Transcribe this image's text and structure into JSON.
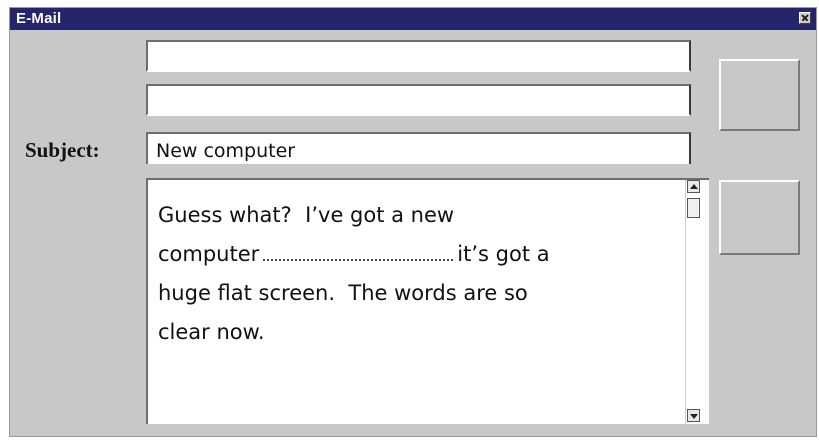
{
  "window": {
    "title": "E-Mail"
  },
  "compose": {
    "to_value": "",
    "cc_value": "",
    "subject_label": "Subject:",
    "subject_value": "New computer",
    "body_line1": "Guess what?  I’ve got a new",
    "body_line2_start": "computer",
    "body_line2_end": "it’s got a",
    "body_line3": "huge flat screen.  The words are so",
    "body_line4": "clear now."
  },
  "buttons": {
    "button1_label": "",
    "button2_label": ""
  }
}
